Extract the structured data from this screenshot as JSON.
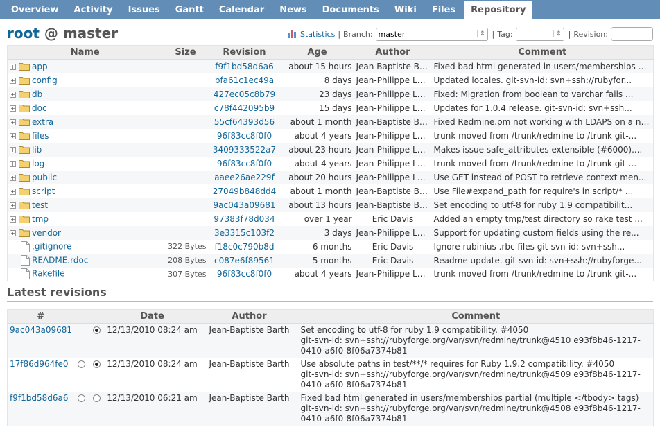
{
  "tabs": [
    {
      "label": "Overview",
      "selected": false
    },
    {
      "label": "Activity",
      "selected": false
    },
    {
      "label": "Issues",
      "selected": false
    },
    {
      "label": "Gantt",
      "selected": false
    },
    {
      "label": "Calendar",
      "selected": false
    },
    {
      "label": "News",
      "selected": false
    },
    {
      "label": "Documents",
      "selected": false
    },
    {
      "label": "Wiki",
      "selected": false
    },
    {
      "label": "Files",
      "selected": false
    },
    {
      "label": "Repository",
      "selected": true
    }
  ],
  "title": {
    "root": "root",
    "at": "@",
    "branch": "master"
  },
  "contextual": {
    "statistics": "Statistics",
    "branch_label": "Branch:",
    "branch_value": "master",
    "tag_label": "Tag:",
    "tag_value": "",
    "revision_label": "Revision:"
  },
  "entries_columns": [
    "Name",
    "Size",
    "Revision",
    "Age",
    "Author",
    "Comment"
  ],
  "entries": [
    {
      "kind": "dir",
      "name": "app",
      "size": "",
      "revision": "f9f1bd58d6a6",
      "age": "about 15 hours",
      "author": "Jean-Baptiste Barth",
      "comment": "Fixed bad html generated in users/memberships p..."
    },
    {
      "kind": "dir",
      "name": "config",
      "size": "",
      "revision": "bfa61c1ec49a",
      "age": "8 days",
      "author": "Jean-Philippe Lang",
      "comment": "Updated locales. git-svn-id: svn+ssh://rubyfor..."
    },
    {
      "kind": "dir",
      "name": "db",
      "size": "",
      "revision": "427ec05c8b79",
      "age": "23 days",
      "author": "Jean-Philippe Lang",
      "comment": "Fixed: Migration from boolean to varchar fails ..."
    },
    {
      "kind": "dir",
      "name": "doc",
      "size": "",
      "revision": "c78f442095b9",
      "age": "15 days",
      "author": "Jean-Philippe Lang",
      "comment": "Updates for 1.0.4 release. git-svn-id: svn+ssh..."
    },
    {
      "kind": "dir",
      "name": "extra",
      "size": "",
      "revision": "55cf64393d56",
      "age": "about 1 month",
      "author": "Jean-Baptiste Barth",
      "comment": "Fixed Redmine.pm not working with LDAPS on a no..."
    },
    {
      "kind": "dir",
      "name": "files",
      "size": "",
      "revision": "96f83cc8f0f0",
      "age": "about 4 years",
      "author": "Jean-Philippe Lang",
      "comment": "trunk moved from /trunk/redmine to /trunk git-..."
    },
    {
      "kind": "dir",
      "name": "lib",
      "size": "",
      "revision": "3409333522a7",
      "age": "about 23 hours",
      "author": "Jean-Philippe Lang",
      "comment": "Makes issue safe_attributes extensible (#6000)...."
    },
    {
      "kind": "dir",
      "name": "log",
      "size": "",
      "revision": "96f83cc8f0f0",
      "age": "about 4 years",
      "author": "Jean-Philippe Lang",
      "comment": "trunk moved from /trunk/redmine to /trunk git-..."
    },
    {
      "kind": "dir",
      "name": "public",
      "size": "",
      "revision": "aaee26ae229f",
      "age": "about 20 hours",
      "author": "Jean-Philippe Lang",
      "comment": "Use GET instead of POST to retrieve context men..."
    },
    {
      "kind": "dir",
      "name": "script",
      "size": "",
      "revision": "27049b848dd4",
      "age": "about 1 month",
      "author": "Jean-Baptiste Barth",
      "comment": "Use File#expand_path for require's in script/* ..."
    },
    {
      "kind": "dir",
      "name": "test",
      "size": "",
      "revision": "9ac043a09681",
      "age": "about 13 hours",
      "author": "Jean-Baptiste Barth",
      "comment": "Set encoding to utf-8 for ruby 1.9 compatibilit..."
    },
    {
      "kind": "dir",
      "name": "tmp",
      "size": "",
      "revision": "97383f78d034",
      "age": "over 1 year",
      "author": "Eric Davis",
      "comment": "Added an empty tmp/test directory so rake test ..."
    },
    {
      "kind": "dir",
      "name": "vendor",
      "size": "",
      "revision": "3e3315c103f2",
      "age": "3 days",
      "author": "Jean-Philippe Lang",
      "comment": "Support for updating custom fields using the re..."
    },
    {
      "kind": "file",
      "name": ".gitignore",
      "size": "322 Bytes",
      "revision": "f18c0c790b8d",
      "age": "6 months",
      "author": "Eric Davis",
      "comment": "Ignore rubinius .rbc files git-svn-id: svn+ssh..."
    },
    {
      "kind": "file",
      "name": "README.rdoc",
      "size": "208 Bytes",
      "revision": "c087e6f89561",
      "age": "5 months",
      "author": "Eric Davis",
      "comment": "Readme update. git-svn-id: svn+ssh://rubyforge..."
    },
    {
      "kind": "file",
      "name": "Rakefile",
      "size": "307 Bytes",
      "revision": "96f83cc8f0f0",
      "age": "about 4 years",
      "author": "Jean-Philippe Lang",
      "comment": "trunk moved from /trunk/redmine to /trunk git-..."
    }
  ],
  "latest_title": "Latest revisions",
  "revisions_columns": [
    "#",
    "",
    "",
    "Date",
    "Author",
    "Comment"
  ],
  "revisions": [
    {
      "id": "9ac043a09681",
      "radio1": "none",
      "radio2": "checked",
      "date": "12/13/2010 08:24 am",
      "author": "Jean-Baptiste Barth",
      "comment": "Set encoding to utf-8 for ruby 1.9 compatibility. #4050\ngit-svn-id: svn+ssh://rubyforge.org/var/svn/redmine/trunk@4510 e93f8b46-1217-\n0410-a6f0-8f06a7374b81"
    },
    {
      "id": "17f86d964fe0",
      "radio1": "unchecked",
      "radio2": "checked",
      "date": "12/13/2010 08:24 am",
      "author": "Jean-Baptiste Barth",
      "comment": "Use absolute paths in test/**/* requires for Ruby 1.9.2 compatibility. #4050\ngit-svn-id: svn+ssh://rubyforge.org/var/svn/redmine/trunk@4509 e93f8b46-1217-\n0410-a6f0-8f06a7374b81"
    },
    {
      "id": "f9f1bd58d6a6",
      "radio1": "unchecked",
      "radio2": "unchecked",
      "date": "12/13/2010 06:21 am",
      "author": "Jean-Baptiste Barth",
      "comment": "Fixed bad html generated in users/memberships partial (multiple </tbody> tags)\ngit-svn-id: svn+ssh://rubyforge.org/var/svn/redmine/trunk@4508 e93f8b46-1217-\n0410-a6f0-8f06a7374b81"
    }
  ]
}
